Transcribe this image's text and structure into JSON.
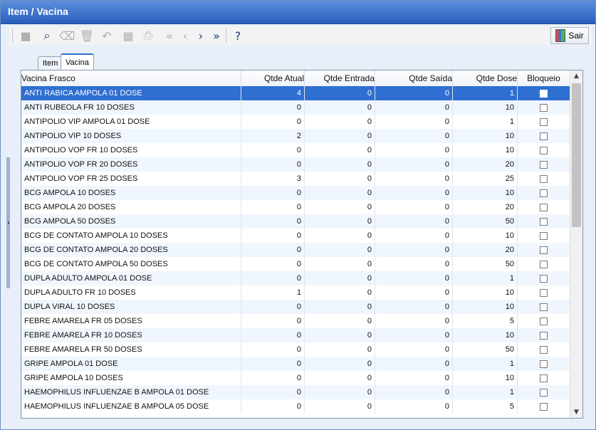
{
  "window": {
    "title": "Item / Vacina"
  },
  "toolbar": {
    "icons": [
      "stop-icon",
      "binoculars-icon",
      "eraser-icon",
      "trash-icon",
      "undo-icon",
      "save-icon",
      "print-icon",
      "first-icon",
      "prev-icon",
      "next-icon",
      "last-icon",
      "help-icon"
    ],
    "exit_label": "Sair"
  },
  "tabs": [
    {
      "label": "Item"
    },
    {
      "label": "Vacina"
    }
  ],
  "grid": {
    "columns": [
      "Vacina Frasco",
      "Qtde Atual",
      "Qtde Entrada",
      "Qtde Saída",
      "Qtde Dose",
      "Bloqueio"
    ],
    "rows": [
      {
        "name": "ANTI RABICA AMPOLA 01 DOSE",
        "atual": "4",
        "entrada": "0",
        "saida": "0",
        "dose": "1"
      },
      {
        "name": "ANTI RUBEOLA FR 10 DOSES",
        "atual": "0",
        "entrada": "0",
        "saida": "0",
        "dose": "10"
      },
      {
        "name": "ANTIPOLIO VIP AMPOLA 01 DOSE",
        "atual": "0",
        "entrada": "0",
        "saida": "0",
        "dose": "1"
      },
      {
        "name": "ANTIPOLIO VIP 10 DOSES",
        "atual": "2",
        "entrada": "0",
        "saida": "0",
        "dose": "10"
      },
      {
        "name": "ANTIPOLIO VOP FR 10 DOSES",
        "atual": "0",
        "entrada": "0",
        "saida": "0",
        "dose": "10"
      },
      {
        "name": "ANTIPOLIO VOP FR 20 DOSES",
        "atual": "0",
        "entrada": "0",
        "saida": "0",
        "dose": "20"
      },
      {
        "name": "ANTIPOLIO VOP FR 25 DOSES",
        "atual": "3",
        "entrada": "0",
        "saida": "0",
        "dose": "25"
      },
      {
        "name": "BCG AMPOLA 10 DOSES",
        "atual": "0",
        "entrada": "0",
        "saida": "0",
        "dose": "10"
      },
      {
        "name": "BCG AMPOLA 20 DOSES",
        "atual": "0",
        "entrada": "0",
        "saida": "0",
        "dose": "20"
      },
      {
        "name": "BCG AMPOLA 50 DOSES",
        "atual": "0",
        "entrada": "0",
        "saida": "0",
        "dose": "50"
      },
      {
        "name": "BCG DE CONTATO AMPOLA 10 DOSES",
        "atual": "0",
        "entrada": "0",
        "saida": "0",
        "dose": "10"
      },
      {
        "name": "BCG DE CONTATO AMPOLA 20 DOSES",
        "atual": "0",
        "entrada": "0",
        "saida": "0",
        "dose": "20"
      },
      {
        "name": "BCG DE CONTATO AMPOLA 50 DOSES",
        "atual": "0",
        "entrada": "0",
        "saida": "0",
        "dose": "50"
      },
      {
        "name": "DUPLA ADULTO AMPOLA 01 DOSE",
        "atual": "0",
        "entrada": "0",
        "saida": "0",
        "dose": "1"
      },
      {
        "name": "DUPLA ADULTO FR 10 DOSES",
        "atual": "1",
        "entrada": "0",
        "saida": "0",
        "dose": "10"
      },
      {
        "name": "DUPLA VIRAL 10 DOSES",
        "atual": "0",
        "entrada": "0",
        "saida": "0",
        "dose": "10"
      },
      {
        "name": "FEBRE AMARELA FR 05 DOSES",
        "atual": "0",
        "entrada": "0",
        "saida": "0",
        "dose": "5"
      },
      {
        "name": "FEBRE AMARELA FR 10 DOSES",
        "atual": "0",
        "entrada": "0",
        "saida": "0",
        "dose": "10"
      },
      {
        "name": "FEBRE AMARELA FR 50 DOSES",
        "atual": "0",
        "entrada": "0",
        "saida": "0",
        "dose": "50"
      },
      {
        "name": "GRIPE AMPOLA 01 DOSE",
        "atual": "0",
        "entrada": "0",
        "saida": "0",
        "dose": "1"
      },
      {
        "name": "GRIPE AMPOLA 10 DOSES",
        "atual": "0",
        "entrada": "0",
        "saida": "0",
        "dose": "10"
      },
      {
        "name": "HAEMOPHILUS INFLUENZAE B AMPOLA 01 DOSE",
        "atual": "0",
        "entrada": "0",
        "saida": "0",
        "dose": "1"
      },
      {
        "name": "HAEMOPHILUS INFLUENZAE B AMPOLA 05 DOSE",
        "atual": "0",
        "entrada": "0",
        "saida": "0",
        "dose": "5"
      }
    ]
  },
  "colors": {
    "title_bar": "#2a5ebd",
    "selected_row": "#2f6fd1",
    "alt_row": "#f0f6fd"
  }
}
